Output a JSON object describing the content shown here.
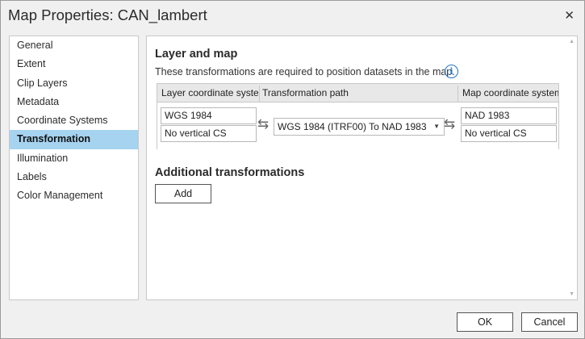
{
  "window": {
    "title": "Map Properties: CAN_lambert",
    "close_glyph": "✕"
  },
  "sidebar": {
    "items": [
      {
        "label": "General",
        "selected": false
      },
      {
        "label": "Extent",
        "selected": false
      },
      {
        "label": "Clip Layers",
        "selected": false
      },
      {
        "label": "Metadata",
        "selected": false
      },
      {
        "label": "Coordinate Systems",
        "selected": false
      },
      {
        "label": "Transformation",
        "selected": true
      },
      {
        "label": "Illumination",
        "selected": false
      },
      {
        "label": "Labels",
        "selected": false
      },
      {
        "label": "Color Management",
        "selected": false
      }
    ]
  },
  "main": {
    "section_title": "Layer and map",
    "description": "These transformations are required to position datasets in the map.",
    "info_icon": "i",
    "grid": {
      "headers": {
        "layer_cs": "Layer coordinate system",
        "path": "Transformation path",
        "map_cs": "Map coordinate system"
      },
      "layer_horizontal": "WGS 1984",
      "layer_vertical": "No vertical CS",
      "transformation": "WGS 1984 (ITRF00) To NAD 1983",
      "map_horizontal": "NAD 1983",
      "map_vertical": "No vertical CS"
    },
    "additional_title": "Additional transformations",
    "add_label": "Add"
  },
  "footer": {
    "ok_label": "OK",
    "cancel_label": "Cancel"
  },
  "colors": {
    "selected_bg": "#a6d3f0",
    "info_blue": "#1d74c4"
  }
}
